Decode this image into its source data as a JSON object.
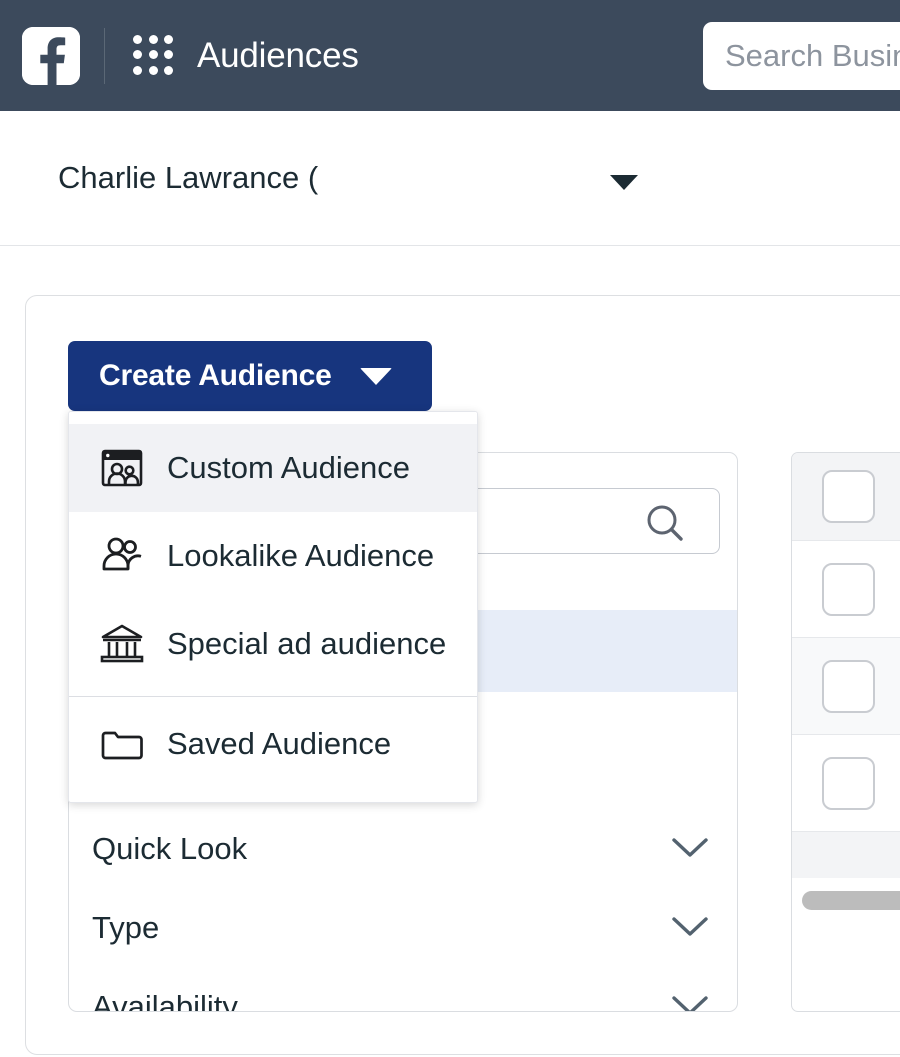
{
  "topbar": {
    "logo_icon": "facebook-logo-icon",
    "apps_icon": "app-grid-icon",
    "title": "Audiences",
    "search": {
      "placeholder": "Search Business Manager",
      "value": "Search Busin"
    }
  },
  "account": {
    "name": "Charlie Lawrance (",
    "caret_icon": "caret-down-icon"
  },
  "toolbar": {
    "create_label": "Create Audience",
    "create_caret_icon": "caret-down-icon",
    "create_color": "#17357e"
  },
  "create_menu": {
    "items": [
      {
        "label": "Custom Audience",
        "icon": "custom-audience-icon",
        "active": true
      },
      {
        "label": "Lookalike Audience",
        "icon": "lookalike-audience-icon",
        "active": false
      },
      {
        "label": "Special ad audience",
        "icon": "special-ad-audience-icon",
        "active": false
      },
      {
        "label": "Saved Audience",
        "icon": "saved-audience-folder-icon",
        "active": false
      }
    ],
    "separator_after_index": 2
  },
  "list_panel": {
    "search": {
      "placeholder": "",
      "value": "",
      "icon": "search-icon"
    },
    "highlight_color": "#e7edf8",
    "filters": [
      {
        "label": "Quick Look",
        "icon": "chevron-down-icon"
      },
      {
        "label": "Type",
        "icon": "chevron-down-icon"
      },
      {
        "label": "Availability",
        "icon": "chevron-down-icon"
      }
    ]
  },
  "table": {
    "rows": [
      {
        "checkbox_icon": "checkbox-unchecked-icon",
        "header": true,
        "alt": false
      },
      {
        "checkbox_icon": "checkbox-unchecked-icon",
        "header": false,
        "alt": false
      },
      {
        "checkbox_icon": "checkbox-unchecked-icon",
        "header": false,
        "alt": true
      },
      {
        "checkbox_icon": "checkbox-unchecked-icon",
        "header": false,
        "alt": false
      }
    ],
    "scrollbar_icon": "horizontal-scrollbar-thumb"
  }
}
